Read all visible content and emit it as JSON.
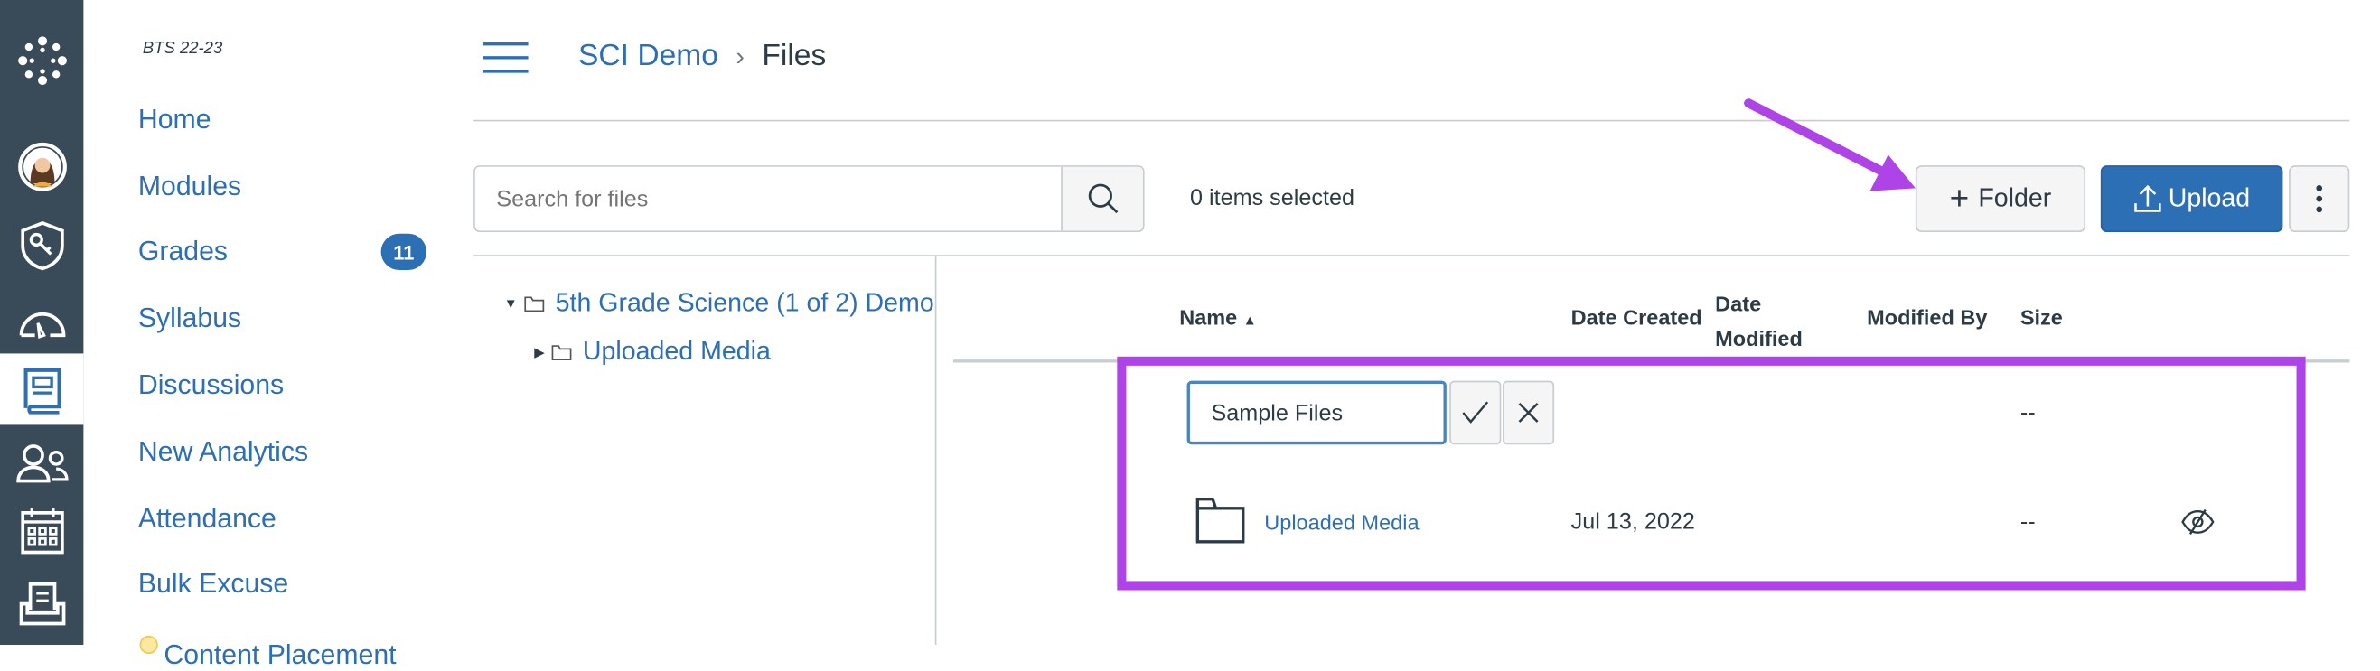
{
  "global_nav": {
    "items": [
      {
        "icon": "canvas-logo-icon"
      },
      {
        "icon": "avatar"
      },
      {
        "icon": "admin-shield-key-icon"
      },
      {
        "icon": "dashboard-gauge-icon"
      },
      {
        "icon": "courses-book-icon",
        "active": true
      },
      {
        "icon": "groups-people-icon"
      },
      {
        "icon": "calendar-icon"
      },
      {
        "icon": "inbox-icon"
      }
    ]
  },
  "course_nav": {
    "term": "BTS 22-23",
    "items": [
      {
        "label": "Home"
      },
      {
        "label": "Modules"
      },
      {
        "label": "Grades",
        "badge": "11"
      },
      {
        "label": "Syllabus"
      },
      {
        "label": "Discussions"
      },
      {
        "label": "New Analytics"
      },
      {
        "label": "Attendance"
      },
      {
        "label": "Bulk Excuse"
      },
      {
        "label": "Content Placement",
        "icon": "lightbulb-icon"
      }
    ]
  },
  "header": {
    "breadcrumb": [
      "SCI Demo",
      "Files"
    ],
    "separator": "›"
  },
  "toolbar": {
    "search_placeholder": "Search for files",
    "selection_status": "0 items selected",
    "folder_label": "Folder",
    "upload_label": "Upload"
  },
  "tree": {
    "root": "5th Grade Science (1 of 2) Demo",
    "children": [
      "Uploaded Media"
    ]
  },
  "table": {
    "columns": {
      "name": "Name",
      "date_created": "Date Created",
      "date_modified_1": "Date",
      "date_modified_2": "Modified",
      "modified_by": "Modified By",
      "size": "Size"
    },
    "new_folder": {
      "value": "Sample Files",
      "size": "--"
    },
    "rows": [
      {
        "name": "Uploaded Media",
        "date_created": "Jul 13, 2022",
        "date_modified": "",
        "modified_by": "",
        "size": "--",
        "status_icon": "eye-off-icon"
      }
    ]
  },
  "colors": {
    "nav_bg": "#394b58",
    "link": "#2d6fb5",
    "upload_bg": "#2d6fb5",
    "annotation": "#ae44e8"
  }
}
